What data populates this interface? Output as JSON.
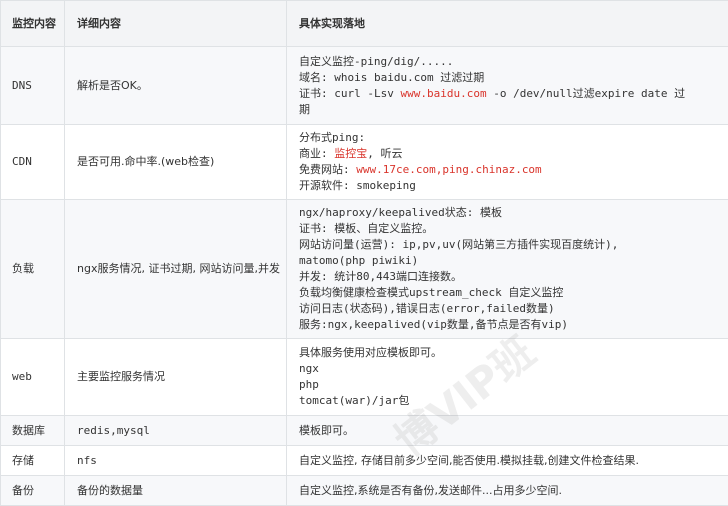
{
  "table": {
    "headers": [
      "监控内容",
      "详细内容",
      "具体实现落地"
    ],
    "rows": [
      {
        "item": "DNS",
        "detail": "解析是否OK。",
        "impl": [
          [
            {
              "t": "自定义监控-ping/dig/....."
            }
          ],
          [
            {
              "t": "域名: whois baidu.com 过滤过期"
            }
          ],
          [
            {
              "t": "证书: curl -Lsv "
            },
            {
              "t": "www.baidu.com",
              "link": true
            },
            {
              "t": " -o /dev/null过滤expire date 过"
            }
          ],
          [
            {
              "t": "期"
            }
          ]
        ]
      },
      {
        "item": "CDN",
        "detail": "是否可用.命中率.(web检查)",
        "impl": [
          [
            {
              "t": "分布式ping:"
            }
          ],
          [
            {
              "t": "商业: "
            },
            {
              "t": "监控宝",
              "link": true
            },
            {
              "t": ", 听云"
            }
          ],
          [
            {
              "t": "免费网站: "
            },
            {
              "t": "www.17ce.com,ping.chinaz.com",
              "link": true
            }
          ],
          [
            {
              "t": "开源软件: smokeping"
            }
          ]
        ]
      },
      {
        "item": "负载",
        "detail": "ngx服务情况, 证书过期, 网站访问量,并发",
        "impl": [
          [
            {
              "t": "ngx/haproxy/keepalived状态: 模板"
            }
          ],
          [
            {
              "t": "证书: 模板、自定义监控。"
            }
          ],
          [
            {
              "t": "网站访问量(运营): ip,pv,uv(网站第三方插件实现百度统计),"
            }
          ],
          [
            {
              "t": "matomo(php piwiki)"
            }
          ],
          [
            {
              "t": "并发: 统计80,443端口连接数。"
            }
          ],
          [
            {
              "t": "负载均衡健康检查模式upstream_check 自定义监控"
            }
          ],
          [
            {
              "t": "访问日志(状态码),错误日志(error,failed数量)"
            }
          ],
          [
            {
              "t": "服务:ngx,keepalived(vip数量,备节点是否有vip)"
            }
          ]
        ]
      },
      {
        "item": "web",
        "detail": "主要监控服务情况",
        "impl": [
          [
            {
              "t": "具体服务使用对应模板即可。"
            }
          ],
          [
            {
              "t": "ngx"
            }
          ],
          [
            {
              "t": "php"
            }
          ],
          [
            {
              "t": "tomcat(war)/jar包"
            }
          ]
        ]
      },
      {
        "item": "数据库",
        "detail": "redis,mysql",
        "impl": [
          [
            {
              "t": "模板即可。"
            }
          ]
        ]
      },
      {
        "item": "存储",
        "detail": "nfs",
        "impl": [
          [
            {
              "t": "自定义监控, 存储目前多少空间,能否使用.模拟挂载,创建文件检查结果."
            }
          ]
        ]
      },
      {
        "item": "备份",
        "detail": "备份的数据量",
        "impl": [
          [
            {
              "t": "自定义监控,系统是否有备份,发送邮件...占用多少空间."
            }
          ]
        ]
      }
    ]
  },
  "watermark": "博VIP班"
}
